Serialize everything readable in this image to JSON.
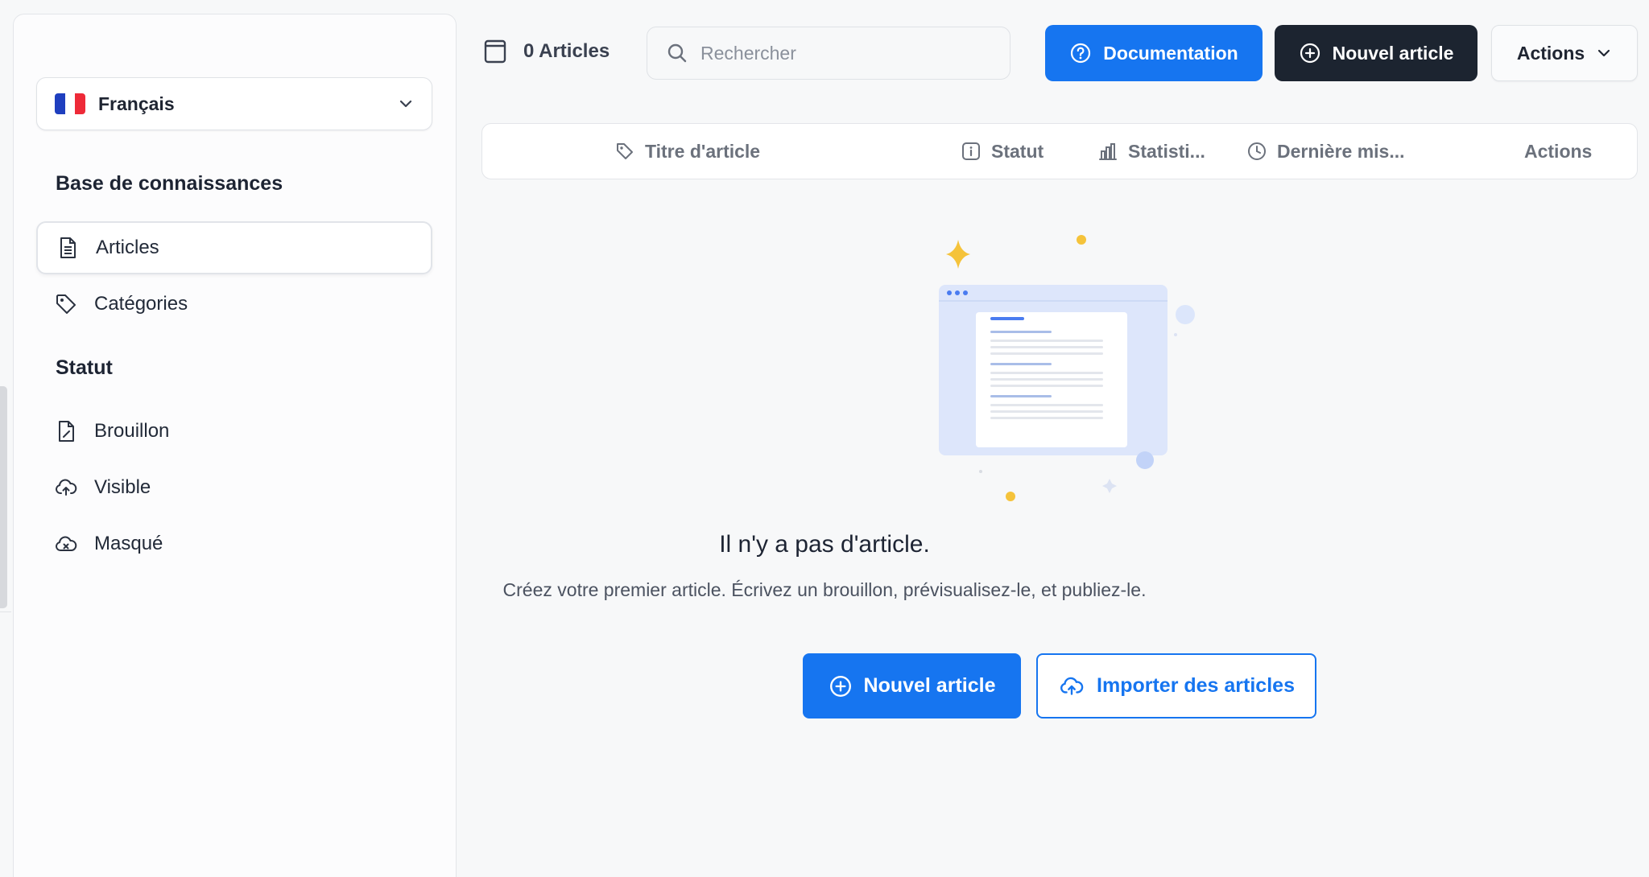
{
  "sidebar": {
    "language": {
      "label": "Français",
      "flag_colors": [
        "#1f3fbf",
        "#ffffff",
        "#ee2a38"
      ]
    },
    "knowledge_base_title": "Base de connaissances",
    "kb_items": [
      {
        "label": "Articles",
        "icon": "document-icon",
        "active": true
      },
      {
        "label": "Catégories",
        "icon": "tag-icon",
        "active": false
      }
    ],
    "status_title": "Statut",
    "status_items": [
      {
        "label": "Brouillon",
        "icon": "draft-icon"
      },
      {
        "label": "Visible",
        "icon": "cloud-upload-icon"
      },
      {
        "label": "Masqué",
        "icon": "cloud-hidden-icon"
      }
    ]
  },
  "topbar": {
    "count_label": "0 Articles",
    "search_placeholder": "Rechercher",
    "documentation_label": "Documentation",
    "new_article_label": "Nouvel article",
    "actions_label": "Actions"
  },
  "table": {
    "columns": [
      {
        "label": "Titre d'article",
        "icon": "tag-icon"
      },
      {
        "label": "Statut",
        "icon": "info-icon"
      },
      {
        "label": "Statisti...",
        "icon": "bar-chart-icon"
      },
      {
        "label": "Dernière mis...",
        "icon": "clock-icon"
      },
      {
        "label": "Actions",
        "icon": ""
      }
    ]
  },
  "empty_state": {
    "title": "Il n'y a pas d'article.",
    "subtitle": "Créez votre premier article. Écrivez un brouillon, prévisualisez-le, et publiez-le.",
    "new_article_label": "Nouvel article",
    "import_label": "Importer des articles"
  },
  "colors": {
    "primary": "#1675f0",
    "dark": "#1c2430",
    "accent_yellow": "#f5c33b"
  }
}
